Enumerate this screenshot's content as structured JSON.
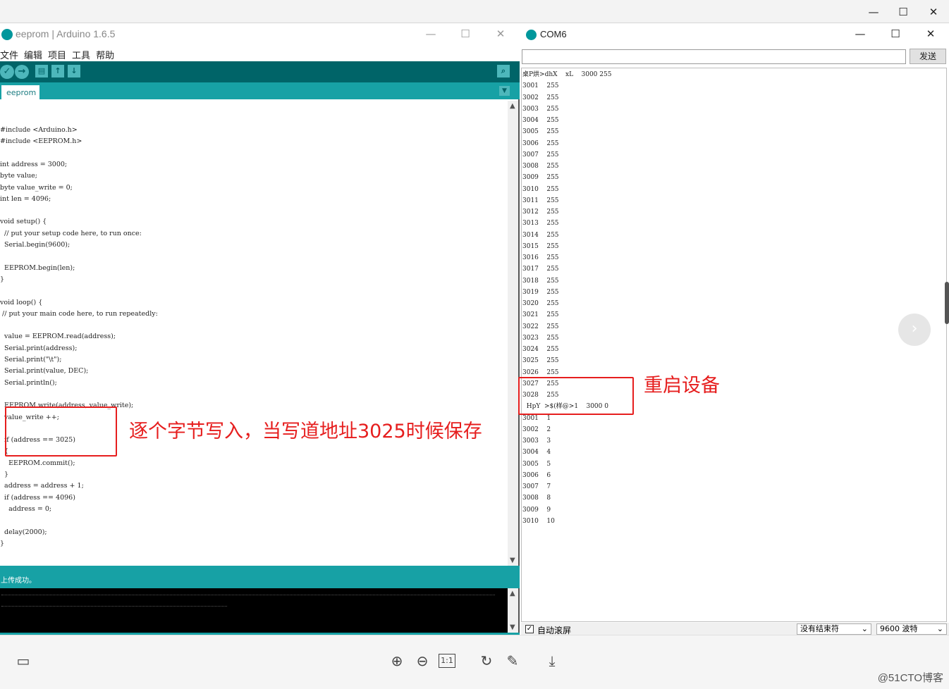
{
  "outer_window": {
    "minimize": "—",
    "maximize": "☐",
    "close": "✕"
  },
  "arduino": {
    "title": "eeprom | Arduino 1.6.5",
    "menu": [
      "文件",
      "编辑",
      "项目",
      "工具",
      "帮助"
    ],
    "toolbar": {
      "verify": "✓",
      "upload": "→",
      "new": "▤",
      "open": "↑",
      "save": "↓",
      "serial_monitor": "⌕"
    },
    "tab": "eeprom",
    "code": [
      "#include <Arduino.h>",
      "#include <EEPROM.h>",
      "",
      "int address = 3000;",
      "byte value;",
      "byte value_write = 0;",
      "int len = 4096;",
      "",
      "void setup() {",
      "  // put your setup code here, to run once:",
      "  Serial.begin(9600);",
      "",
      "  EEPROM.begin(len);",
      "}",
      "",
      "void loop() {",
      " // put your main code here, to run repeatedly:",
      "",
      "  value = EEPROM.read(address);",
      "  Serial.print(address);",
      "  Serial.print(\"\\t\");",
      "  Serial.print(value, DEC);",
      "  Serial.println();",
      "",
      "  EEPROM.write(address, value_write);",
      "  value_write ++;",
      "",
      "  if (address == 3025)",
      "  {",
      "    EEPROM.commit();",
      "  }",
      "  address = address + 1;",
      "  if (address == 4096)",
      "    address = 0;",
      "",
      "  delay(2000);",
      "}"
    ],
    "status": "上传成功。"
  },
  "com": {
    "title": "COM6",
    "send_label": "发送",
    "input_value": "",
    "output": [
      "桌P烘>dhX    xL    3000 255",
      "3001    255",
      "3002    255",
      "3003    255",
      "3004    255",
      "3005    255",
      "3006    255",
      "3007    255",
      "3008    255",
      "3009    255",
      "3010    255",
      "3011    255",
      "3012    255",
      "3013    255",
      "3014    255",
      "3015    255",
      "3016    255",
      "3017    255",
      "3018    255",
      "3019    255",
      "3020    255",
      "3021    255",
      "3022    255",
      "3023    255",
      "3024    255",
      "3025    255",
      "3026    255",
      "3027    255",
      "3028    255",
      "  HpY  >$(样@>1    3000 0",
      "3001    1",
      "3002    2",
      "3003    3",
      "3004    4",
      "3005    5",
      "3006    6",
      "3007    7",
      "3008    8",
      "3009    9",
      "3010    10"
    ],
    "autoscroll_label": "自动滚屏",
    "autoscroll_checked": "✓",
    "line_ending": "没有结束符",
    "baud": "9600  波特"
  },
  "annotations": {
    "left": "逐个字节写入，当写道地址3025时候保存",
    "right": "重启设备",
    "color": "#e61e1e"
  },
  "viewer": {
    "watermark": "@51CTO博客",
    "icons": [
      "thumbnail-icon",
      "zoom-in-icon",
      "zoom-out-icon",
      "actual-size-icon",
      "rotate-icon",
      "edit-icon",
      "download-icon"
    ],
    "actual_size_label": "1:1"
  }
}
